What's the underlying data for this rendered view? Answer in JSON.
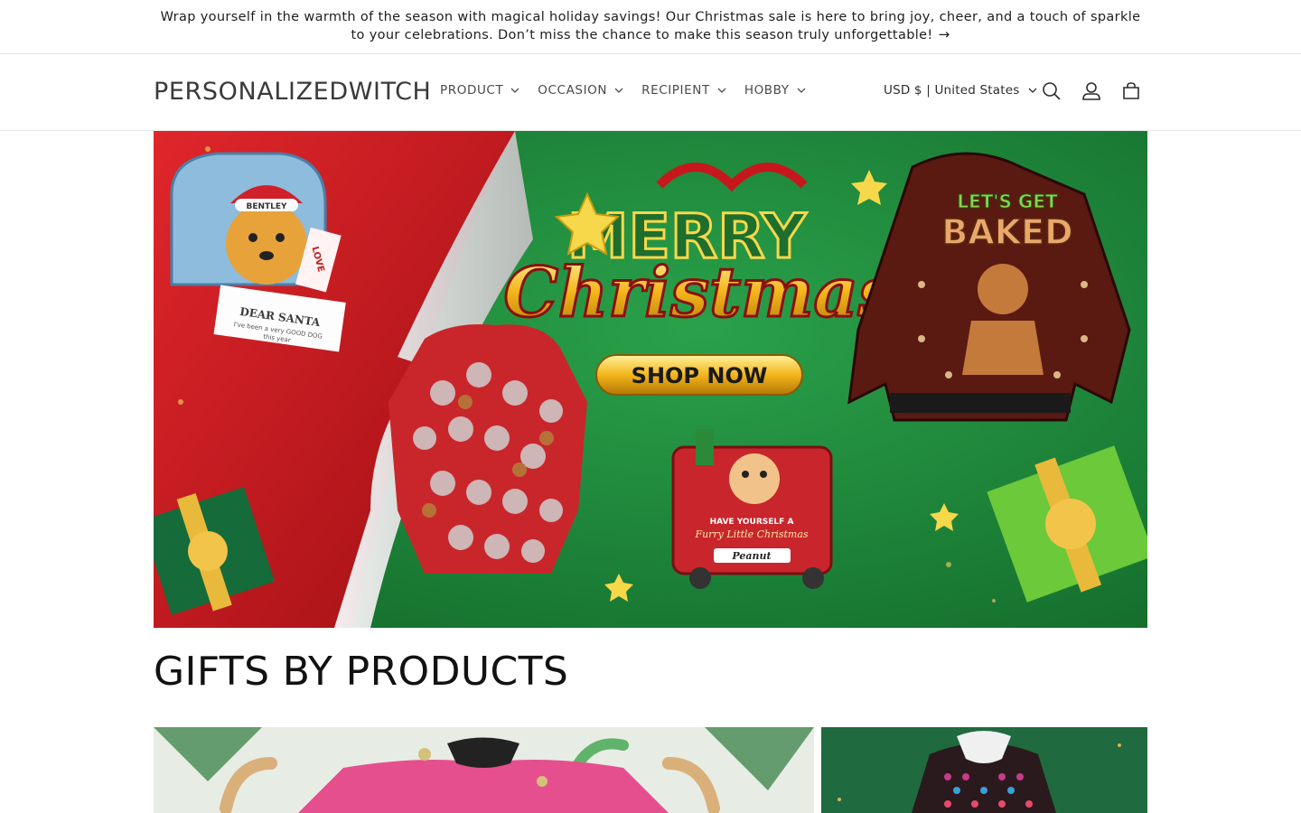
{
  "announcement": {
    "text": "Wrap yourself in the warmth of the season with magical holiday savings! Our Christmas sale is here to bring joy, cheer, and a touch of sparkle to your celebrations. Don’t miss the chance to make this season truly unforgettable!",
    "arrow": "→"
  },
  "header": {
    "logo": "PERSONALIZEDWITCH",
    "nav": [
      {
        "label": "PRODUCT"
      },
      {
        "label": "OCCASION"
      },
      {
        "label": "RECIPIENT"
      },
      {
        "label": "HOBBY"
      }
    ],
    "currency": "USD $ | United States",
    "icons": [
      "search-icon",
      "account-icon",
      "cart-icon"
    ]
  },
  "hero": {
    "headline_top": "MERRY",
    "headline_bottom": "Christmas",
    "cta": "SHOP NOW",
    "sweater_text_1": "LET'S GET",
    "sweater_text_2": "BAKED",
    "mailbox_name": "BENTLEY",
    "letter_title": "DEAR SANTA",
    "letter_line_1": "I've been a very GOOD DOG",
    "letter_line_2": "this year",
    "love_note": "LOVE",
    "ornament_line_1": "HAVE YOURSELF A",
    "ornament_line_2": "Furry Little Christmas",
    "ornament_name": "Peanut",
    "colors": {
      "green": "#1f8a3d",
      "red": "#c8161d",
      "gold": "#f3b51a"
    }
  },
  "section": {
    "title": "GIFTS BY PRODUCTS"
  },
  "colors": {
    "text": "#121212",
    "border": "#e4e4e4"
  }
}
